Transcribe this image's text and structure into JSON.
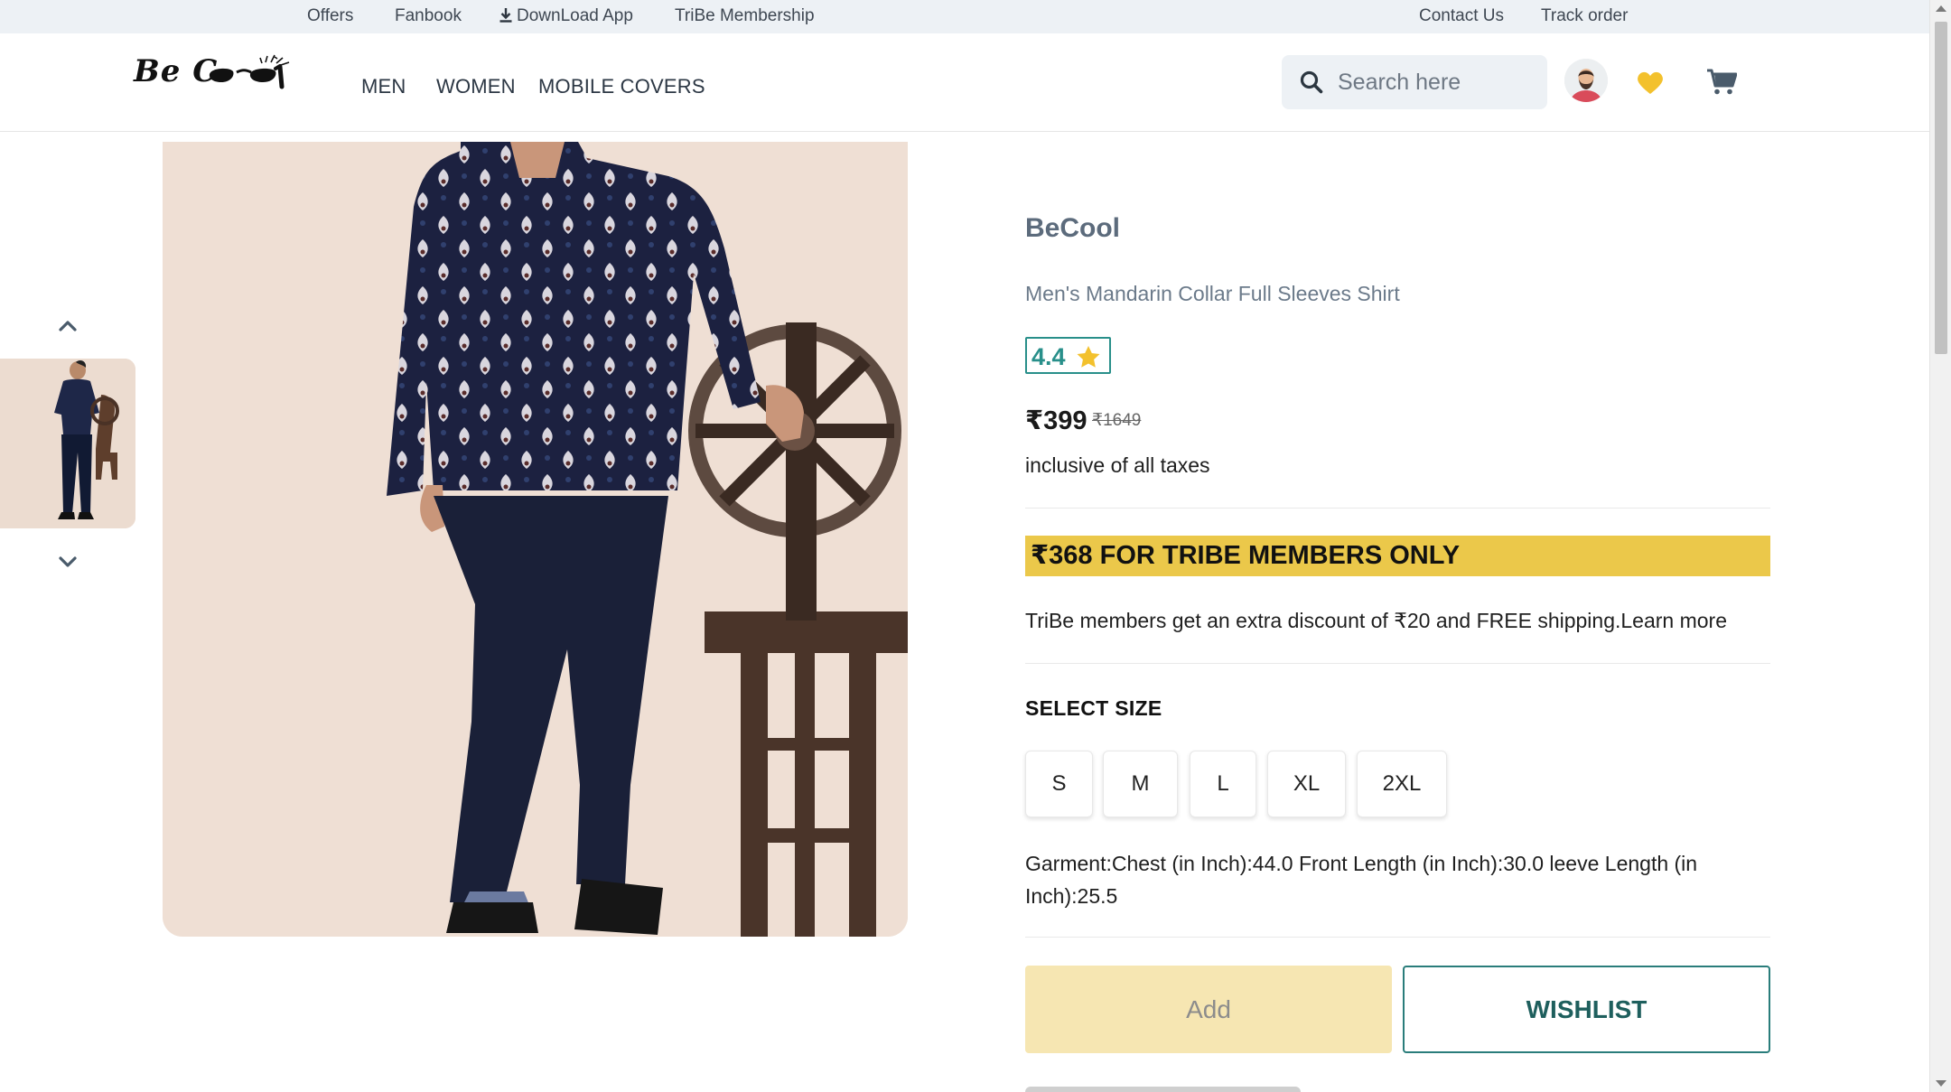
{
  "topbar": {
    "offers": "Offers",
    "fanbook": "Fanbook",
    "download_app": "DownLoad App",
    "tribe_membership": "TriBe Membership",
    "contact_us": "Contact Us",
    "track_order": "Track order"
  },
  "header": {
    "logo_text": "Be C",
    "nav": [
      "MEN",
      "WOMEN",
      "MOBILE COVERS"
    ],
    "search_placeholder": "Search here",
    "icons": [
      "search-icon",
      "avatar",
      "heart-icon",
      "cart-icon"
    ],
    "colors": {
      "heart": "#f3c12d",
      "cart": "#4a5b6b"
    }
  },
  "gallery": {
    "thumbnails_count": 1,
    "icons": [
      "chevron-up-icon",
      "chevron-down-icon"
    ]
  },
  "product": {
    "brand": "BeCool",
    "name": "Men's Mandarin Collar Full Sleeves Shirt",
    "rating": "4.4",
    "price": "₹399",
    "mrp": "₹1649",
    "taxes_note": "inclusive of all taxes",
    "tribe_banner": "₹368 FOR TRIBE MEMBERS ONLY",
    "tribe_text": "TriBe members get an extra discount of ₹20 and FREE shipping.",
    "learn_more": "Learn more",
    "size_title": "SELECT SIZE",
    "sizes": [
      "S",
      "M",
      "L",
      "XL",
      "2XL"
    ],
    "garment_details": "Garment:Chest (in Inch):44.0 Front Length (in Inch):30.0 leeve Length (in Inch):25.5",
    "add_label": "Add",
    "wishlist_label": "WISHLIST",
    "colors": {
      "banner": "#ebc84a",
      "rating": "#288f8a",
      "add_button": "#f6e6b2",
      "wishlist_border": "#2a7d7b"
    }
  }
}
